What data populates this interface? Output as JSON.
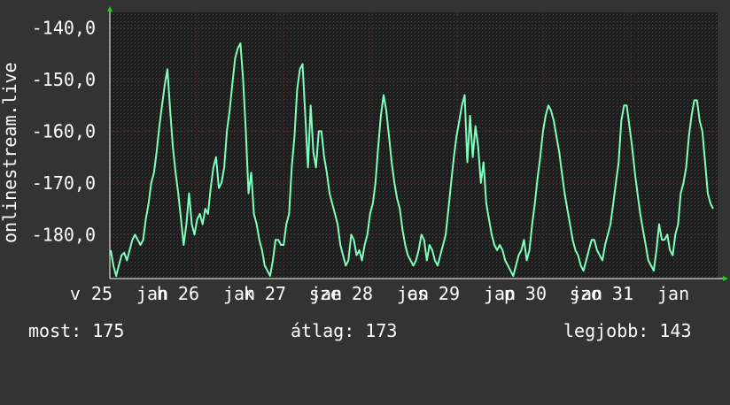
{
  "chart_data": {
    "type": "line",
    "title": "",
    "ylabel": "onlinestream.live",
    "xlabel": "",
    "ylim": [
      -188.5,
      -137
    ],
    "yticks": [
      -180,
      -170,
      -160,
      -150,
      -140
    ],
    "ytick_labels": [
      "-180,0",
      "-170,0",
      "-160,0",
      "-150,0",
      "-140,0"
    ],
    "xtick_labels": [
      "v 25",
      "jan",
      "h 26",
      "jan",
      "k 27",
      "jan",
      "sze 28",
      "jan",
      "cs 29",
      "jan",
      "p 30",
      "jan",
      "szo 31",
      "jan"
    ],
    "grid": true,
    "line_color": "#7fffbf",
    "background_color": "#1f1f1f",
    "series": [
      {
        "values": [
          -183,
          -186,
          -188,
          -186,
          -184,
          -183.5,
          -185,
          -183,
          -181,
          -180,
          -181,
          -182,
          -181,
          -177,
          -174,
          -170,
          -168,
          -164,
          -159,
          -155,
          -151,
          -148,
          -156,
          -163,
          -168,
          -172,
          -177,
          -182,
          -178,
          -172,
          -178,
          -180,
          -177,
          -176,
          -178,
          -175,
          -176,
          -171,
          -167,
          -165,
          -171,
          -170,
          -167,
          -160,
          -156,
          -151,
          -146,
          -144,
          -143,
          -150,
          -160,
          -172,
          -168,
          -176,
          -178,
          -181,
          -183,
          -186,
          -187,
          -188,
          -185,
          -181,
          -181,
          -182,
          -182,
          -178,
          -176,
          -167,
          -161,
          -152,
          -148,
          -147,
          -157,
          -167,
          -155,
          -164,
          -167,
          -160,
          -160,
          -165,
          -168,
          -172,
          -174,
          -176,
          -178,
          -182,
          -184,
          -186,
          -185,
          -180,
          -181,
          -184,
          -183,
          -185,
          -182,
          -180,
          -176,
          -174,
          -170,
          -163,
          -157,
          -153,
          -156,
          -161,
          -166,
          -170,
          -173,
          -175,
          -179,
          -182,
          -184,
          -185,
          -186,
          -185,
          -183,
          -180,
          -181,
          -185,
          -182,
          -183,
          -185,
          -186,
          -184,
          -182,
          -180,
          -175,
          -170,
          -165,
          -161,
          -158,
          -155,
          -153,
          -166,
          -157,
          -165,
          -159,
          -163,
          -170,
          -166,
          -174,
          -177,
          -180,
          -182,
          -183,
          -182,
          -183,
          -185,
          -186,
          -187,
          -188,
          -186,
          -184,
          -183,
          -181,
          -185,
          -183,
          -178,
          -174,
          -169,
          -165,
          -160,
          -157,
          -155,
          -156,
          -158,
          -161,
          -164,
          -168,
          -172,
          -175,
          -178,
          -181,
          -183,
          -184,
          -186,
          -187,
          -185,
          -183,
          -181,
          -181,
          -183,
          -184,
          -185,
          -182,
          -180,
          -178,
          -174,
          -170,
          -166,
          -158,
          -155,
          -155,
          -159,
          -163,
          -168,
          -172,
          -176,
          -179,
          -182,
          -185,
          -186,
          -187,
          -183,
          -178,
          -181,
          -181,
          -180,
          -183,
          -184,
          -180,
          -178,
          -172,
          -170,
          -167,
          -161,
          -157,
          -154,
          -154,
          -158,
          -160,
          -166,
          -172,
          -174,
          -175
        ]
      }
    ]
  },
  "stats": {
    "now_label": "most:",
    "now_value": "175",
    "avg_label": "átlag:",
    "avg_value": "173",
    "max_label": "legjobb:",
    "max_value": "143"
  }
}
